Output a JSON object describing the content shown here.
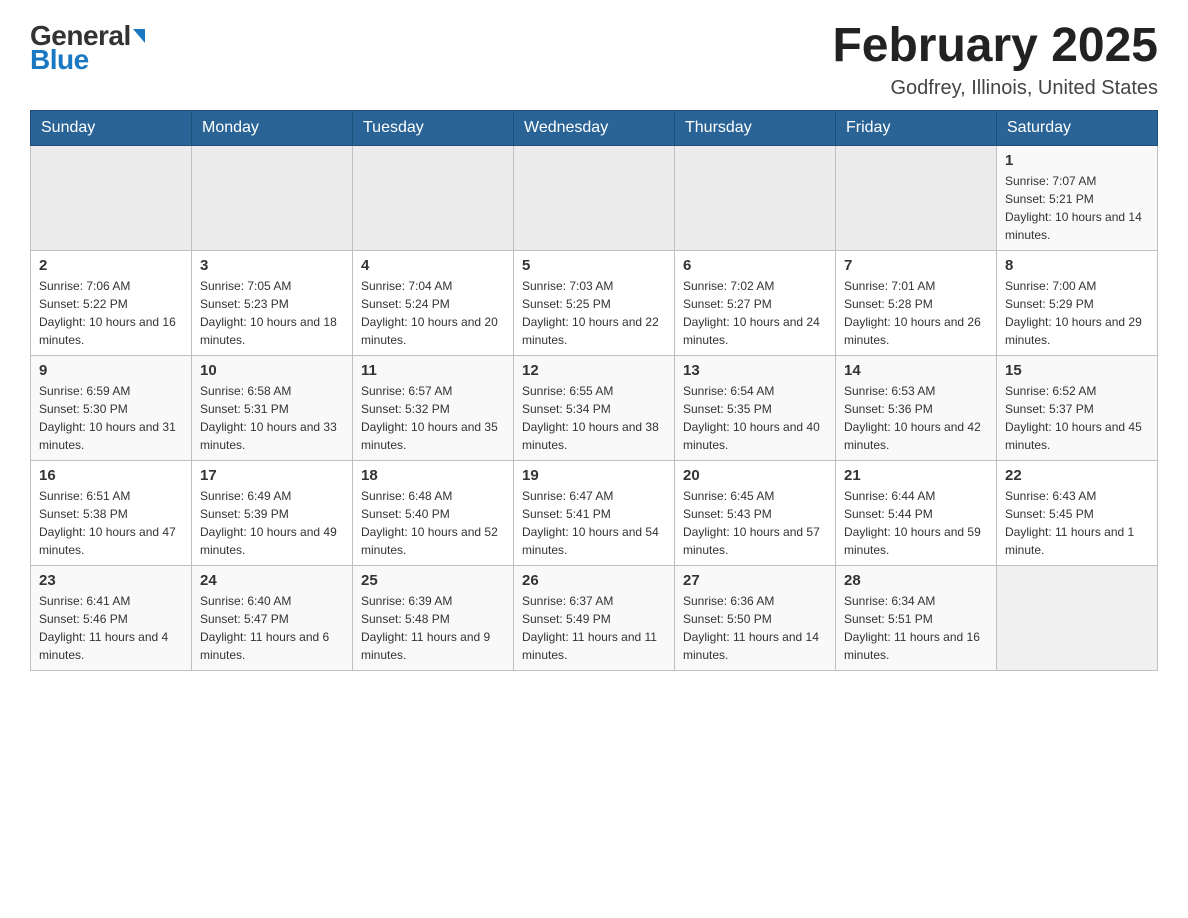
{
  "logo": {
    "general": "General",
    "blue": "Blue",
    "tagline": "GeneralBlue"
  },
  "title": {
    "month_year": "February 2025",
    "location": "Godfrey, Illinois, United States"
  },
  "weekdays": [
    "Sunday",
    "Monday",
    "Tuesday",
    "Wednesday",
    "Thursday",
    "Friday",
    "Saturday"
  ],
  "weeks": [
    [
      {
        "day": "",
        "info": ""
      },
      {
        "day": "",
        "info": ""
      },
      {
        "day": "",
        "info": ""
      },
      {
        "day": "",
        "info": ""
      },
      {
        "day": "",
        "info": ""
      },
      {
        "day": "",
        "info": ""
      },
      {
        "day": "1",
        "info": "Sunrise: 7:07 AM\nSunset: 5:21 PM\nDaylight: 10 hours and 14 minutes."
      }
    ],
    [
      {
        "day": "2",
        "info": "Sunrise: 7:06 AM\nSunset: 5:22 PM\nDaylight: 10 hours and 16 minutes."
      },
      {
        "day": "3",
        "info": "Sunrise: 7:05 AM\nSunset: 5:23 PM\nDaylight: 10 hours and 18 minutes."
      },
      {
        "day": "4",
        "info": "Sunrise: 7:04 AM\nSunset: 5:24 PM\nDaylight: 10 hours and 20 minutes."
      },
      {
        "day": "5",
        "info": "Sunrise: 7:03 AM\nSunset: 5:25 PM\nDaylight: 10 hours and 22 minutes."
      },
      {
        "day": "6",
        "info": "Sunrise: 7:02 AM\nSunset: 5:27 PM\nDaylight: 10 hours and 24 minutes."
      },
      {
        "day": "7",
        "info": "Sunrise: 7:01 AM\nSunset: 5:28 PM\nDaylight: 10 hours and 26 minutes."
      },
      {
        "day": "8",
        "info": "Sunrise: 7:00 AM\nSunset: 5:29 PM\nDaylight: 10 hours and 29 minutes."
      }
    ],
    [
      {
        "day": "9",
        "info": "Sunrise: 6:59 AM\nSunset: 5:30 PM\nDaylight: 10 hours and 31 minutes."
      },
      {
        "day": "10",
        "info": "Sunrise: 6:58 AM\nSunset: 5:31 PM\nDaylight: 10 hours and 33 minutes."
      },
      {
        "day": "11",
        "info": "Sunrise: 6:57 AM\nSunset: 5:32 PM\nDaylight: 10 hours and 35 minutes."
      },
      {
        "day": "12",
        "info": "Sunrise: 6:55 AM\nSunset: 5:34 PM\nDaylight: 10 hours and 38 minutes."
      },
      {
        "day": "13",
        "info": "Sunrise: 6:54 AM\nSunset: 5:35 PM\nDaylight: 10 hours and 40 minutes."
      },
      {
        "day": "14",
        "info": "Sunrise: 6:53 AM\nSunset: 5:36 PM\nDaylight: 10 hours and 42 minutes."
      },
      {
        "day": "15",
        "info": "Sunrise: 6:52 AM\nSunset: 5:37 PM\nDaylight: 10 hours and 45 minutes."
      }
    ],
    [
      {
        "day": "16",
        "info": "Sunrise: 6:51 AM\nSunset: 5:38 PM\nDaylight: 10 hours and 47 minutes."
      },
      {
        "day": "17",
        "info": "Sunrise: 6:49 AM\nSunset: 5:39 PM\nDaylight: 10 hours and 49 minutes."
      },
      {
        "day": "18",
        "info": "Sunrise: 6:48 AM\nSunset: 5:40 PM\nDaylight: 10 hours and 52 minutes."
      },
      {
        "day": "19",
        "info": "Sunrise: 6:47 AM\nSunset: 5:41 PM\nDaylight: 10 hours and 54 minutes."
      },
      {
        "day": "20",
        "info": "Sunrise: 6:45 AM\nSunset: 5:43 PM\nDaylight: 10 hours and 57 minutes."
      },
      {
        "day": "21",
        "info": "Sunrise: 6:44 AM\nSunset: 5:44 PM\nDaylight: 10 hours and 59 minutes."
      },
      {
        "day": "22",
        "info": "Sunrise: 6:43 AM\nSunset: 5:45 PM\nDaylight: 11 hours and 1 minute."
      }
    ],
    [
      {
        "day": "23",
        "info": "Sunrise: 6:41 AM\nSunset: 5:46 PM\nDaylight: 11 hours and 4 minutes."
      },
      {
        "day": "24",
        "info": "Sunrise: 6:40 AM\nSunset: 5:47 PM\nDaylight: 11 hours and 6 minutes."
      },
      {
        "day": "25",
        "info": "Sunrise: 6:39 AM\nSunset: 5:48 PM\nDaylight: 11 hours and 9 minutes."
      },
      {
        "day": "26",
        "info": "Sunrise: 6:37 AM\nSunset: 5:49 PM\nDaylight: 11 hours and 11 minutes."
      },
      {
        "day": "27",
        "info": "Sunrise: 6:36 AM\nSunset: 5:50 PM\nDaylight: 11 hours and 14 minutes."
      },
      {
        "day": "28",
        "info": "Sunrise: 6:34 AM\nSunset: 5:51 PM\nDaylight: 11 hours and 16 minutes."
      },
      {
        "day": "",
        "info": ""
      }
    ]
  ]
}
